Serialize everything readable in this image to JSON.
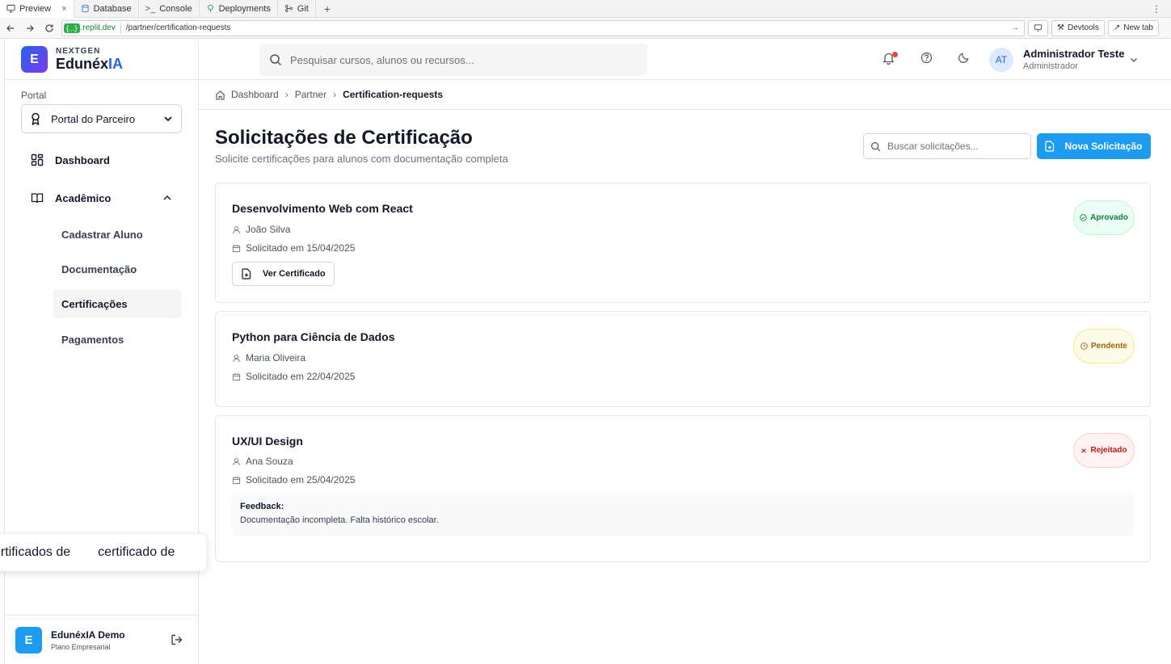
{
  "browser": {
    "tabs": [
      {
        "label": "Preview",
        "icon": "monitor-icon",
        "active": true
      },
      {
        "label": "Database",
        "icon": "database-icon"
      },
      {
        "label": "Console",
        "icon": "terminal-icon"
      },
      {
        "label": "Deployments",
        "icon": "deploy-icon"
      },
      {
        "label": "Git",
        "icon": "git-icon"
      }
    ],
    "host_pill": "{...}",
    "host": ".replit.dev",
    "path": "/partner/certification-requests",
    "devtools_label": "Devtools",
    "newtab_label": "New tab"
  },
  "sidebar": {
    "brand_sub": "NEXTGEN",
    "brand_name_main": "Edunéx",
    "brand_name_accent": "IA",
    "brand_logo_letter": "E",
    "portal_label": "Portal",
    "portal_value": "Portal do Parceiro",
    "nav": {
      "dashboard": "Dashboard",
      "academico": "Acadêmico",
      "sub": [
        "Cadastrar Aluno",
        "Documentação",
        "Certificações",
        "Pagamentos"
      ],
      "active_sub": "Certificações"
    },
    "tooltip": {
      "part1": "ertificados de",
      "part2": "certificado de"
    },
    "footer": {
      "avatar_letter": "E",
      "name": "EdunéxIA Demo",
      "plan": "Plano Empresarial"
    }
  },
  "header": {
    "search_placeholder": "Pesquisar cursos, alunos ou recursos...",
    "user_initials": "AT",
    "user_name": "Administrador Teste",
    "user_role": "Administrador"
  },
  "breadcrumb": [
    "Dashboard",
    "Partner",
    "Certification-requests"
  ],
  "main": {
    "title": "Solicitações de Certificação",
    "subtitle": "Solicite certificações para alunos com documentação completa",
    "search_placeholder": "Buscar solicitações...",
    "new_button": "Nova Solicitação",
    "requests": [
      {
        "course": "Desenvolvimento Web com React",
        "student": "João Silva",
        "date": "Solicitado em 15/04/2025",
        "status": "Aprovado",
        "status_color": "#15803d",
        "action": "Ver Certificado"
      },
      {
        "course": "Python para Ciência de Dados",
        "student": "Maria Oliveira",
        "date": "Solicitado em 22/04/2025",
        "status": "Pendente",
        "status_color": "#a16207"
      },
      {
        "course": "UX/UI Design",
        "student": "Ana Souza",
        "date": "Solicitado em 25/04/2025",
        "status": "Rejeitado",
        "status_color": "#b91c1c",
        "feedback_label": "Feedback:",
        "feedback_text": "Documentação incompleta. Falta histórico escolar."
      }
    ]
  }
}
